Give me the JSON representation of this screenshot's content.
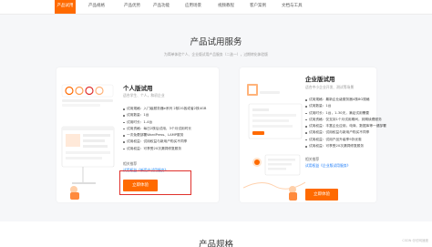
{
  "nav": {
    "tabs": [
      "产品试用",
      "产品规格",
      "产品优势",
      "产品功能",
      "应用场景",
      "视频教程",
      "客户案例",
      "文档与工具"
    ],
    "active_index": 0
  },
  "section": {
    "title": "产品试用服务",
    "subtitle": "为简单体验个人、企业版试用产品服务（二选一），过期转化体验版"
  },
  "personal": {
    "title": "个人版试用",
    "desc": "适合学生、个人，和初企业",
    "features": [
      "试用规格：入门级服务器e系列 2核2G各或者2核4GB",
      "试用数量：1台",
      "试用时长：1-4台",
      "试用资格：每日2核后试用，3个月试用时长",
      "一次免费部署WordPress、LAMP服务",
      "试用权益：试用权益与新用户购买不同享",
      "试用权益：可享受20次漏洞修复服务"
    ],
    "rec_label": "相关推荐",
    "rec_link": "试用权益《新用户试用服务》",
    "cta": "立即体验"
  },
  "enterprise": {
    "title": "企业版试用",
    "desc": "适合中小企业开发、测试等场景",
    "features": [
      "试用规格：最新企业级服务器4核8G规格",
      "试用数量：1台",
      "试用时长：1台，1-30天，满足试用需要",
      "试用资格：仅支持1个月试用期间，到期续费服务",
      "试用权益：丰富企业应用，电商、数据库等一键部署",
      "试用权益：试用权益与新用户购买不同享",
      "试用权益：试用产品升级享9折优惠",
      "试用权益：可享受20次漏洞修复服务"
    ],
    "rec_label": "相关推荐",
    "rec_link": "试用权益《企业版试用服务》",
    "cta": "立即体验"
  },
  "bottom": {
    "title": "产品规格"
  },
  "watermark": "CSDN @仿网速度",
  "colors": {
    "accent": "#ff6a00",
    "link": "#1a7af8",
    "highlight": "#e0312c"
  }
}
